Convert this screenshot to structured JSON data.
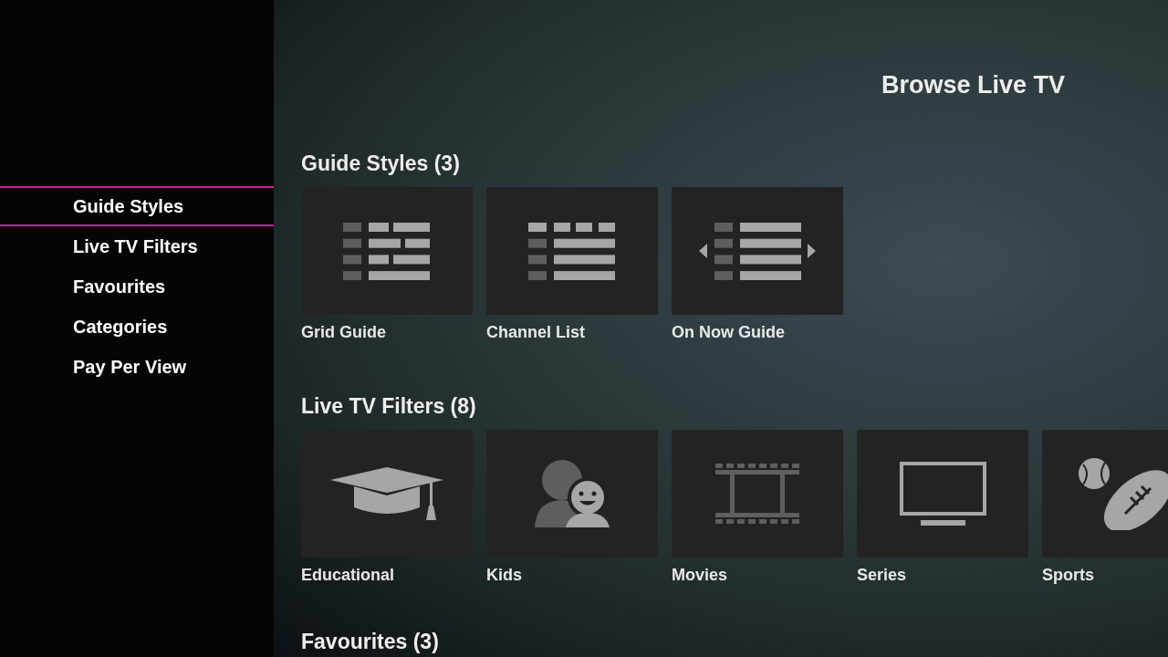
{
  "sidebar": {
    "items": [
      {
        "label": "Guide Styles",
        "selected": true
      },
      {
        "label": "Live TV Filters",
        "selected": false
      },
      {
        "label": "Favourites",
        "selected": false
      },
      {
        "label": "Categories",
        "selected": false
      },
      {
        "label": "Pay Per View",
        "selected": false
      }
    ]
  },
  "page_title": "Browse Live TV",
  "sections": [
    {
      "heading": "Guide Styles (3)",
      "tiles": [
        {
          "label": "Grid Guide",
          "kind": "grid"
        },
        {
          "label": "Channel List",
          "kind": "list"
        },
        {
          "label": "On Now Guide",
          "kind": "onnow"
        }
      ]
    },
    {
      "heading": "Live TV Filters (8)",
      "tiles": [
        {
          "label": "Educational",
          "kind": "cap"
        },
        {
          "label": "Kids",
          "kind": "kids"
        },
        {
          "label": "Movies",
          "kind": "film"
        },
        {
          "label": "Series",
          "kind": "tv"
        },
        {
          "label": "Sports",
          "kind": "sports"
        }
      ]
    },
    {
      "heading": "Favourites (3)"
    }
  ]
}
